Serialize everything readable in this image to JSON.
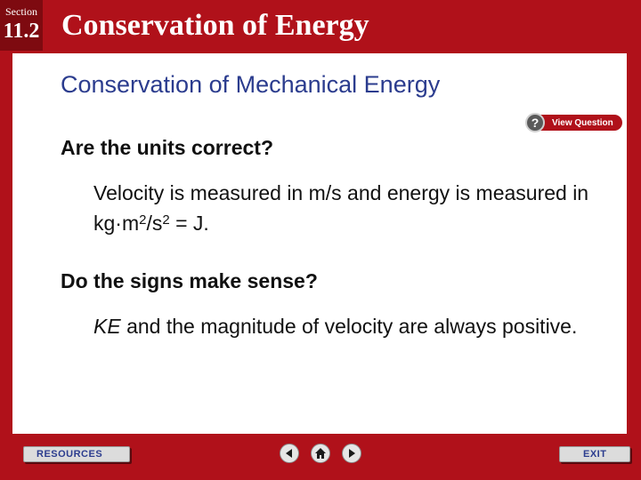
{
  "header": {
    "section_label": "Section",
    "section_number": "11.2",
    "title": "Conservation of Energy"
  },
  "slide": {
    "title": "Conservation of Mechanical Energy",
    "question_1": "Are the units correct?",
    "answer_1": {
      "part_1": "Velocity is measured in m/s and energy is measured in kg·m",
      "sup_1": "2",
      "part_2": "/s",
      "sup_2": "2",
      "part_3": " = J."
    },
    "question_2": "Do the signs make sense?",
    "answer_2": {
      "term": "KE",
      "rest": " and the magnitude of velocity are always positive."
    }
  },
  "view_question": {
    "icon_symbol": "?",
    "label": "View Question"
  },
  "footer": {
    "resources_label": "RESOURCES",
    "exit_label": "EXIT"
  },
  "navigation": {
    "prev_icon": "left-arrow-icon",
    "home_icon": "home-icon",
    "next_icon": "right-arrow-icon"
  },
  "colors": {
    "frame": "#b0111a",
    "title_blue": "#2b3c8e"
  }
}
